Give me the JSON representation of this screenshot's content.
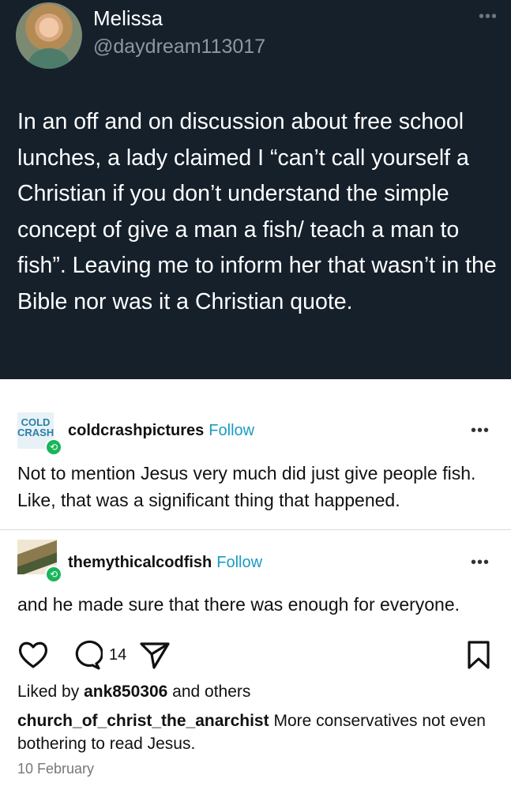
{
  "tweet": {
    "name": "Melissa",
    "handle": "@daydream113017",
    "more_icon": "more-dots-icon",
    "text": "In an off and on discussion about free school lunches, a lady claimed I “can’t call yourself a Christian if you don’t understand the simple concept of give a man a fish/ teach a man to fish”. Leaving me to inform her that wasn’t in the Bible nor was it a Christian quote."
  },
  "replies": [
    {
      "username": "coldcrashpictures",
      "follow_label": "Follow",
      "avatar_text": "COLD CRASH",
      "text": "Not to mention Jesus very much did just give people fish. Like, that was a significant thing that happened."
    },
    {
      "username": "themythicalcodfish",
      "follow_label": "Follow",
      "text": "and he made sure that there was enough for everyone."
    }
  ],
  "actions": {
    "like_icon": "heart-icon",
    "comment_icon": "comment-bubble-icon",
    "comment_count": "14",
    "share_icon": "send-icon",
    "save_icon": "bookmark-icon"
  },
  "liked_by": {
    "prefix": "Liked by",
    "user": "ank850306",
    "suffix": "and others"
  },
  "caption": {
    "author": "church_of_christ_the_anarchist",
    "text": "More conservatives not even bothering to read Jesus."
  },
  "date": "10 February",
  "colors": {
    "tweet_background": "#15202b",
    "follow_link": "#1a9bc3",
    "reblog_badge": "#18b55a"
  }
}
